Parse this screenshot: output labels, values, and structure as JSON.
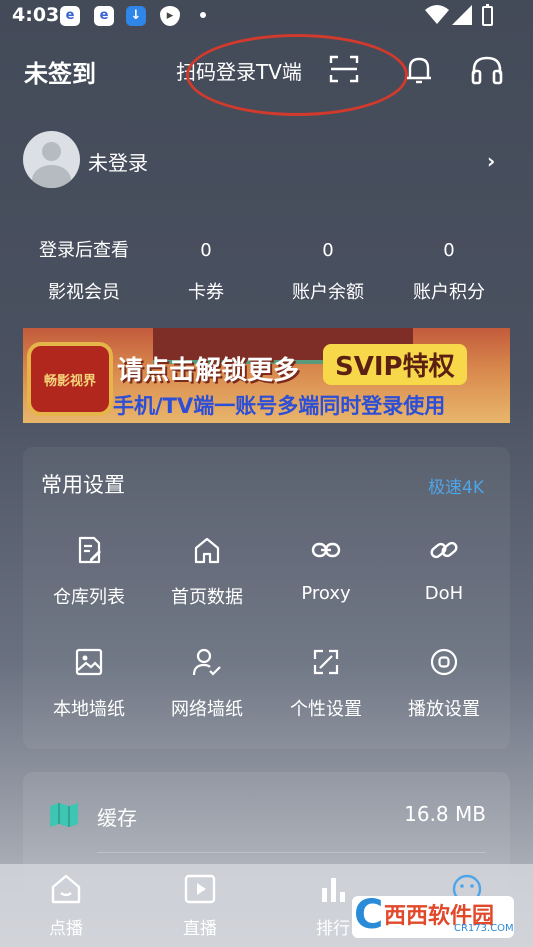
{
  "status_bar": {
    "time": "4:03",
    "icons": [
      "app-icon",
      "app-icon",
      "download-icon",
      "shield-icon",
      "dot-icon",
      "wifi-icon",
      "signal-icon",
      "battery-icon"
    ]
  },
  "header": {
    "sign_status": "未签到",
    "scan_login_label": "扫码登录TV端",
    "icons": [
      "scan-icon",
      "bell-icon",
      "headset-icon"
    ]
  },
  "profile": {
    "name": "未登录"
  },
  "stats": [
    {
      "value": "登录后查看",
      "label": "影视会员"
    },
    {
      "value": "0",
      "label": "卡券"
    },
    {
      "value": "0",
      "label": "账户余额"
    },
    {
      "value": "0",
      "label": "账户积分"
    }
  ],
  "banner": {
    "logo_text": "畅影视界",
    "line1": "请点击解锁更多",
    "svip": "SVIP特权",
    "line2": "手机/TV端一账号多端同时登录使用"
  },
  "settings": {
    "title": "常用设置",
    "speed_label": "极速4K",
    "items": [
      {
        "label": "仓库列表",
        "icon": "edit-doc-icon"
      },
      {
        "label": "首页数据",
        "icon": "home-icon"
      },
      {
        "label": "Proxy",
        "icon": "link-icon"
      },
      {
        "label": "DoH",
        "icon": "chain-icon"
      },
      {
        "label": "本地墙纸",
        "icon": "image-icon"
      },
      {
        "label": "网络墙纸",
        "icon": "user-check-icon"
      },
      {
        "label": "个性设置",
        "icon": "expand-icon"
      },
      {
        "label": "播放设置",
        "icon": "record-icon"
      }
    ]
  },
  "cache": {
    "label": "缓存",
    "size": "16.8 MB"
  },
  "bottom_nav": [
    {
      "label": "点播",
      "icon": "home-outline-icon"
    },
    {
      "label": "直播",
      "icon": "play-screen-icon"
    },
    {
      "label": "排行",
      "icon": "bar-chart-icon"
    },
    {
      "label": "",
      "icon": "smile-icon"
    }
  ],
  "watermark": {
    "text": "西西软件园",
    "sub": "CR173.COM"
  },
  "colors": {
    "accent": "#4ea5e8",
    "annotation": "#d13a2c",
    "cache_icon": "#3ec6b2"
  }
}
